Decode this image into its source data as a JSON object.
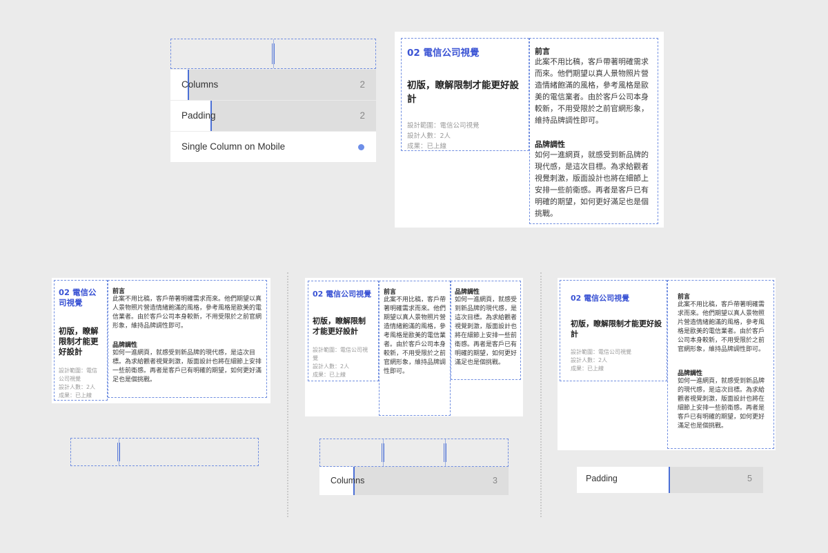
{
  "settings_panel": {
    "columns_label": "Columns",
    "columns_value": "2",
    "padding_label": "Padding",
    "padding_value": "2",
    "mobile_label": "Single Column on Mobile",
    "mobile_toggle_on": true
  },
  "card": {
    "title": "02 電信公司視覺",
    "subtitle": "初版，瞭解限制才能更好設計",
    "meta_scope": "設計範圍：電信公司視覺",
    "meta_people": "設計人數：2人",
    "meta_result": "成果：已上線",
    "foreword_heading": "前言",
    "foreword_text": "此案不用比稿，客戶帶著明確需求而來。他們期望以真人景物照片營造情緒飽滿的風格，參考風格是歐美的電信業者。由於客戶公司本身較新，不用受限於之前官網形象，維持品牌調性即可。",
    "brand_heading": "品牌調性",
    "brand_text": "如何一進網頁，就感受到新品牌的現代感，是這次目標。為求給觀者視覺刺激，版面設計也將在細節上安排一些前衛感。再者是客戶已有明確的期望，如何更好滿足也是個挑戰。"
  },
  "card_variant_left": {
    "title_line1": "02 電信公",
    "title_line2": "司視覺",
    "subtitle_line1": "初版，瞭解",
    "subtitle_line2": "限制才能更",
    "subtitle_line3": "好設計",
    "meta_line1": "設計範圍：電信",
    "meta_line2": "公司視覺",
    "meta_line3": "設計人數：2人",
    "meta_line4": "成果：已上線"
  },
  "card_variant_mid": {
    "subtitle_line1": "初版，瞭解限制",
    "subtitle_line2": "才能更好設計",
    "meta_line1": "設計範圍：電信公司視",
    "meta_line2": "覺"
  },
  "columns_bottom": {
    "label": "Columns",
    "value": "3"
  },
  "padding_bottom": {
    "label": "Padding",
    "value": "5"
  }
}
